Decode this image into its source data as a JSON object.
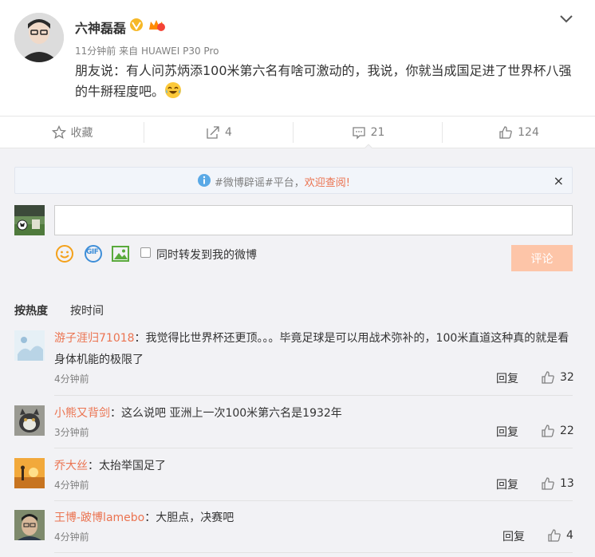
{
  "post": {
    "author": "六神磊磊",
    "time": "11分钟前",
    "source_prefix": "来自",
    "source": "HUAWEI P30 Pro",
    "text": "朋友说：有人问苏炳添100米第六名有啥可激动的，我说，你就当成国足进了世界杯八强的牛掰程度吧。"
  },
  "actions": {
    "favorite": "收藏",
    "repost_count": "4",
    "comment_count": "21",
    "like_count": "124"
  },
  "notice": {
    "prefix": "#微博辟谣#平台，",
    "link": "欢迎查阅!",
    "close": "×"
  },
  "compose": {
    "placeholder": "",
    "repost_label": "同时转发到我的微博",
    "submit_label": "评论",
    "gif_label": "GIF"
  },
  "sort": {
    "hot": "按热度",
    "time": "按时间"
  },
  "comments": [
    {
      "user": "游子涯归71018",
      "text": "：我觉得比世界杯还更顶。。。毕竟足球是可以用战术弥补的，100米直道这种真的就是看身体机能的极限了",
      "time": "4分钟前",
      "reply": "回复",
      "likes": "32"
    },
    {
      "user": "小熊又背剑",
      "text": "：这么说吧  亚洲上一次100米第六名是1932年",
      "time": "3分钟前",
      "reply": "回复",
      "likes": "22"
    },
    {
      "user": "乔大丝",
      "text": "：太抬举国足了",
      "time": "4分钟前",
      "reply": "回复",
      "likes": "13"
    },
    {
      "user": "王博-跛博lamebo",
      "text": "：大胆点，决赛吧",
      "time": "4分钟前",
      "reply": "回复",
      "likes": "4"
    }
  ],
  "colors": {
    "accent": "#eb7350",
    "submit_bg": "#fdc5a8",
    "link_blue": "#1e88e5"
  }
}
